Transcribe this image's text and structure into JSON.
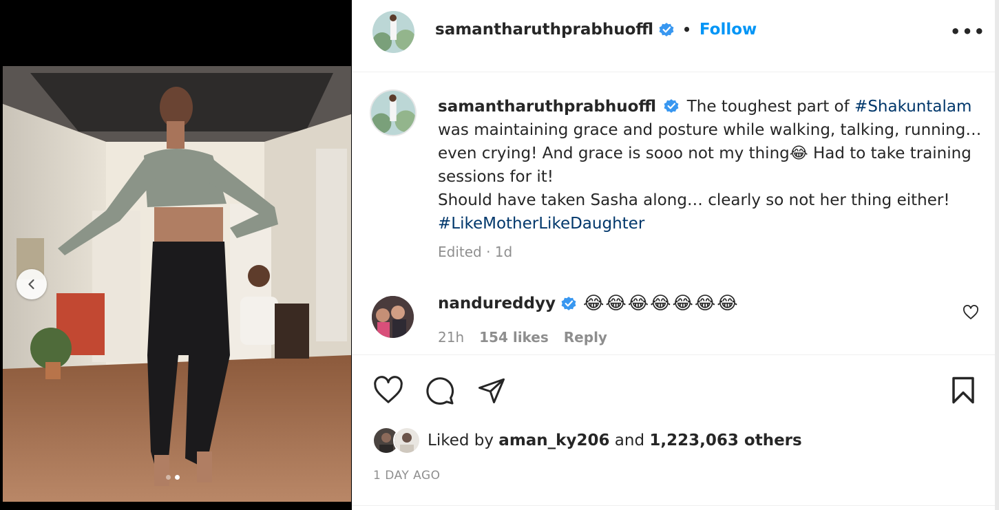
{
  "post": {
    "username": "samantharuthprabhuoffl",
    "follow_label": "Follow",
    "separator": "•",
    "more_label": "•••"
  },
  "caption": {
    "username": "samantharuthprabhuoffl",
    "text_1": "The toughest part of",
    "hashtag_1": "#Shakuntalam",
    "text_2": "was maintaining grace and posture while walking, talking, running… even crying! And grace is sooo not my thing",
    "emoji_1": "😂",
    "text_3": "Had to take training sessions for it!",
    "text_4": "Should have taken Sasha along… clearly so not her thing either!",
    "hashtag_2": "#LikeMotherLikeDaughter",
    "meta": "Edited · 1d"
  },
  "comment": {
    "username": "nandureddyy",
    "text": "😂😂😂😂😂😂😂",
    "time": "21h",
    "likes": "154 likes",
    "reply_label": "Reply"
  },
  "likes": {
    "prefix": "Liked by",
    "user": "aman_ky206",
    "middle": "and",
    "count": "1,223,063 others"
  },
  "date": "1 DAY AGO",
  "carousel": {
    "current": 2,
    "total": 2
  },
  "icons": {
    "verified": "verified-badge-icon",
    "like": "heart-icon",
    "comment": "comment-bubble-icon",
    "share": "paper-plane-icon",
    "save": "bookmark-icon",
    "prev": "chevron-left-icon"
  },
  "colors": {
    "link": "#0095f6",
    "hashtag": "#00376b",
    "muted": "#8e8e8e",
    "verified": "#3897f0"
  }
}
